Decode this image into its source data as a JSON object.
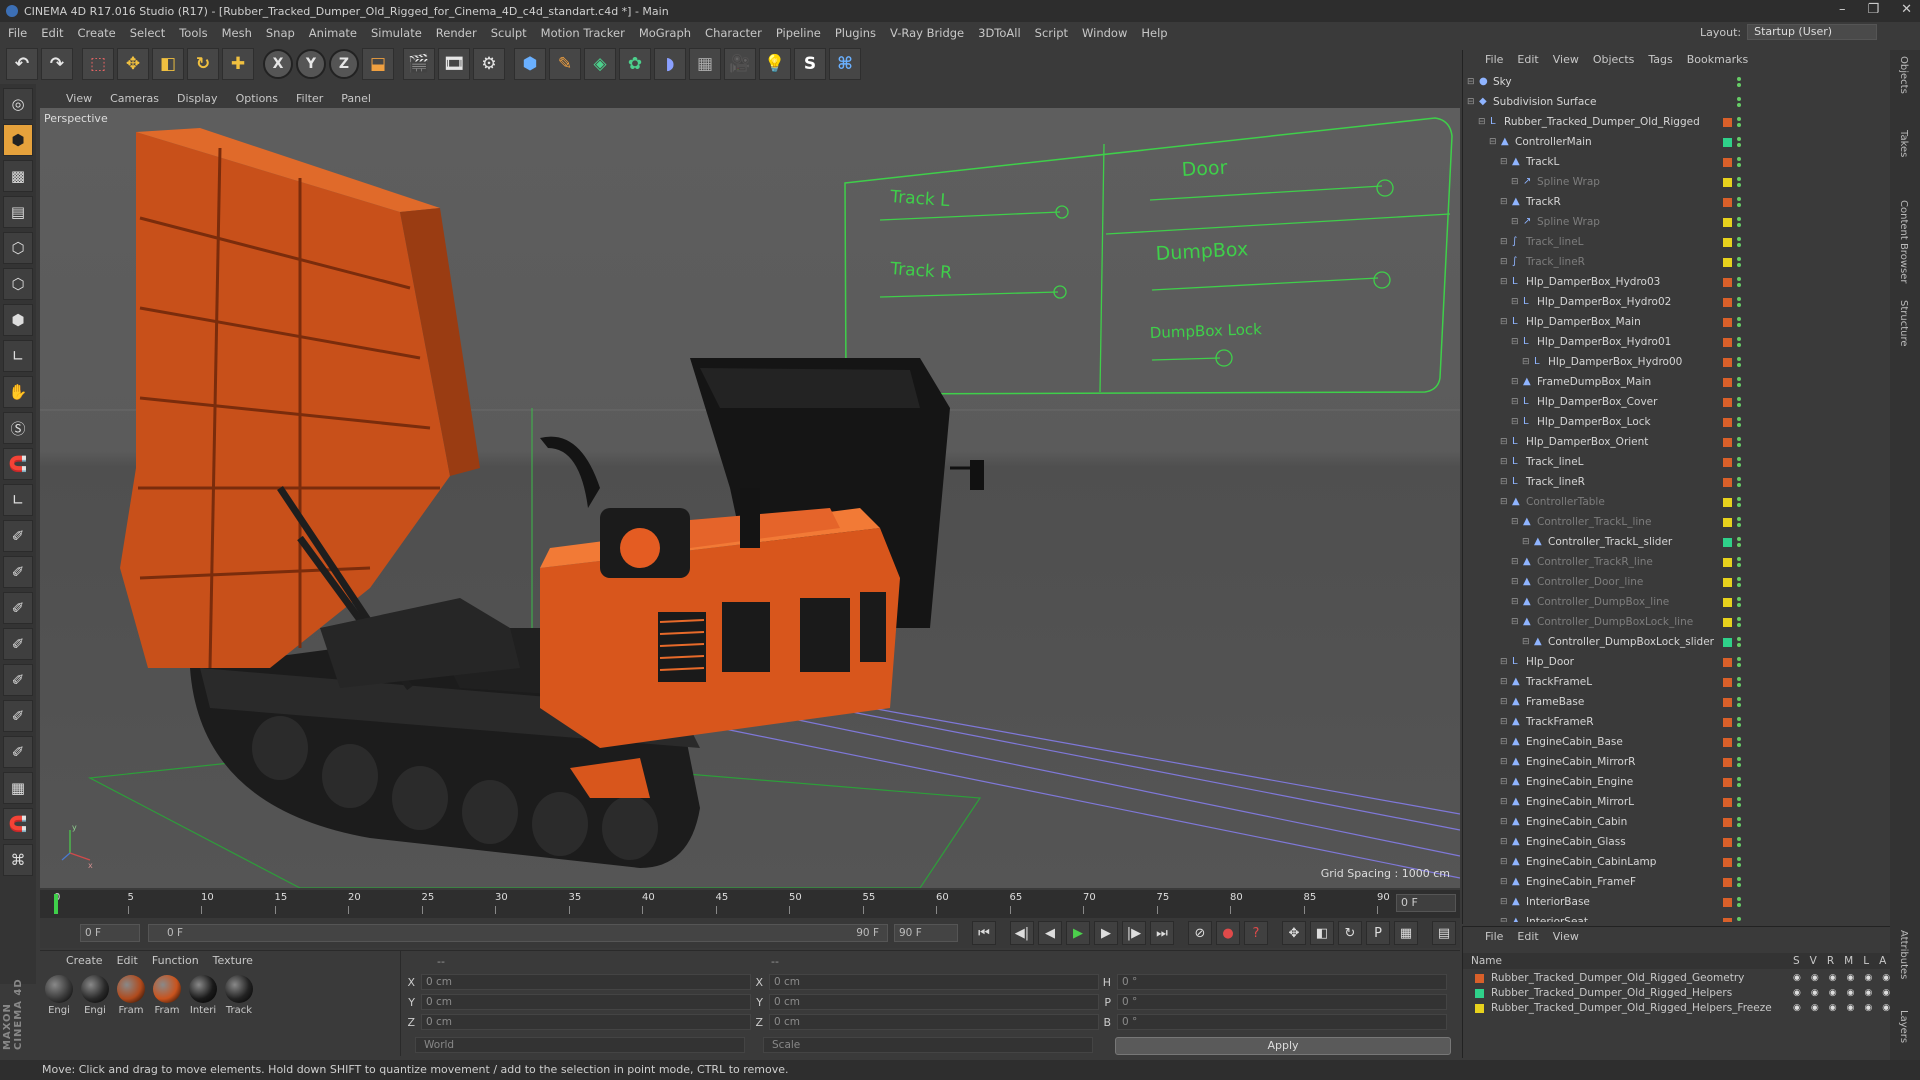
{
  "app": {
    "title": "CINEMA 4D R17.016 Studio (R17) - [Rubber_Tracked_Dumper_Old_Rigged_for_Cinema_4D_c4d_standart.c4d *] - Main",
    "menu": [
      "File",
      "Edit",
      "Create",
      "Select",
      "Tools",
      "Mesh",
      "Snap",
      "Animate",
      "Simulate",
      "Render",
      "Sculpt",
      "Motion Tracker",
      "MoGraph",
      "Character",
      "Pipeline",
      "Plugins",
      "V-Ray Bridge",
      "3DToAll",
      "Script",
      "Window",
      "Help"
    ],
    "layout_label": "Layout:",
    "layout_value": "Startup (User)",
    "maxon": "MAXON CINEMA 4D"
  },
  "toolbar": {
    "axis_x": "X",
    "axis_y": "Y",
    "axis_z": "Z"
  },
  "viewport": {
    "menu": [
      "View",
      "Cameras",
      "Display",
      "Options",
      "Filter",
      "Panel"
    ],
    "label": "Perspective",
    "grid_spacing": "Grid Spacing : 1000 cm",
    "controller_labels": {
      "track_l": "Track L",
      "track_r": "Track R",
      "door": "Door",
      "dumpbox": "DumpBox",
      "dumpbox_lock": "DumpBox Lock"
    },
    "axis_x": "x",
    "axis_y": "y"
  },
  "timeline": {
    "ticks": [
      "0",
      "5",
      "10",
      "15",
      "20",
      "25",
      "30",
      "35",
      "40",
      "45",
      "50",
      "55",
      "60",
      "65",
      "70",
      "75",
      "80",
      "85",
      "90"
    ],
    "current_frame": "0 F",
    "start_field": "0 F",
    "range_start": "0 F",
    "range_end": "90 F",
    "end_field": "90 F"
  },
  "materials": {
    "menu": [
      "Create",
      "Edit",
      "Function",
      "Texture"
    ],
    "items": [
      {
        "label": "Engi",
        "color": "#3a3a3a"
      },
      {
        "label": "Engi",
        "color": "#2a2a2a"
      },
      {
        "label": "Fram",
        "color": "#b04a1c"
      },
      {
        "label": "Fram",
        "color": "#c9531d"
      },
      {
        "label": "Interi",
        "color": "#1a1a1a"
      },
      {
        "label": "Track",
        "color": "#222222"
      }
    ]
  },
  "coords": {
    "header": "--",
    "header2": "--",
    "x_label": "X",
    "x_val": "0 cm",
    "y_label": "Y",
    "y_val": "0 cm",
    "z_label": "Z",
    "z_val": "0 cm",
    "sx_label": "X",
    "sx_val": "0 cm",
    "sy_label": "Y",
    "sy_val": "0 cm",
    "sz_label": "Z",
    "sz_val": "0 cm",
    "h_label": "H",
    "h_val": "0 °",
    "p_label": "P",
    "p_val": "0 °",
    "b_label": "B",
    "b_val": "0 °",
    "world": "World",
    "scale": "Scale",
    "apply": "Apply"
  },
  "objects": {
    "menu": [
      "File",
      "Edit",
      "View",
      "Objects",
      "Tags",
      "Bookmarks"
    ],
    "rows": [
      {
        "name": "Sky",
        "depth": 0,
        "dim": false,
        "layer": "",
        "icon": "●"
      },
      {
        "name": "Subdivision Surface",
        "depth": 0,
        "dim": false,
        "layer": "",
        "icon": "◆"
      },
      {
        "name": "Rubber_Tracked_Dumper_Old_Rigged",
        "depth": 1,
        "dim": false,
        "layer": "#d9602a",
        "icon": "L"
      },
      {
        "name": "ControllerMain",
        "depth": 2,
        "dim": false,
        "layer": "#2fd18a",
        "icon": "▲"
      },
      {
        "name": "TrackL",
        "depth": 3,
        "dim": false,
        "layer": "#d9602a",
        "icon": "▲"
      },
      {
        "name": "Spline Wrap",
        "depth": 4,
        "dim": true,
        "layer": "#e8d21d",
        "icon": "↗"
      },
      {
        "name": "TrackR",
        "depth": 3,
        "dim": false,
        "layer": "#d9602a",
        "icon": "▲"
      },
      {
        "name": "Spline Wrap",
        "depth": 4,
        "dim": true,
        "layer": "#e8d21d",
        "icon": "↗"
      },
      {
        "name": "Track_lineL",
        "depth": 3,
        "dim": true,
        "layer": "#e8d21d",
        "icon": "∫"
      },
      {
        "name": "Track_lineR",
        "depth": 3,
        "dim": true,
        "layer": "#e8d21d",
        "icon": "∫"
      },
      {
        "name": "Hlp_DamperBox_Hydro03",
        "depth": 3,
        "dim": false,
        "layer": "#d9602a",
        "icon": "L"
      },
      {
        "name": "Hlp_DamperBox_Hydro02",
        "depth": 4,
        "dim": false,
        "layer": "#d9602a",
        "icon": "L"
      },
      {
        "name": "Hlp_DamperBox_Main",
        "depth": 3,
        "dim": false,
        "layer": "#d9602a",
        "icon": "L"
      },
      {
        "name": "Hlp_DamperBox_Hydro01",
        "depth": 4,
        "dim": false,
        "layer": "#d9602a",
        "icon": "L"
      },
      {
        "name": "Hlp_DamperBox_Hydro00",
        "depth": 5,
        "dim": false,
        "layer": "#d9602a",
        "icon": "L"
      },
      {
        "name": "FrameDumpBox_Main",
        "depth": 4,
        "dim": false,
        "layer": "#d9602a",
        "icon": "▲"
      },
      {
        "name": "Hlp_DamperBox_Cover",
        "depth": 4,
        "dim": false,
        "layer": "#d9602a",
        "icon": "L"
      },
      {
        "name": "Hlp_DamperBox_Lock",
        "depth": 4,
        "dim": false,
        "layer": "#d9602a",
        "icon": "L"
      },
      {
        "name": "Hlp_DamperBox_Orient",
        "depth": 3,
        "dim": false,
        "layer": "#d9602a",
        "icon": "L"
      },
      {
        "name": "Track_lineL",
        "depth": 3,
        "dim": false,
        "layer": "#d9602a",
        "icon": "L"
      },
      {
        "name": "Track_lineR",
        "depth": 3,
        "dim": false,
        "layer": "#d9602a",
        "icon": "L"
      },
      {
        "name": "ControllerTable",
        "depth": 3,
        "dim": true,
        "layer": "#e8d21d",
        "icon": "▲"
      },
      {
        "name": "Controller_TrackL_line",
        "depth": 4,
        "dim": true,
        "layer": "#e8d21d",
        "icon": "▲"
      },
      {
        "name": "Controller_TrackL_slider",
        "depth": 5,
        "dim": false,
        "layer": "#2fd18a",
        "icon": "▲"
      },
      {
        "name": "Controller_TrackR_line",
        "depth": 4,
        "dim": true,
        "layer": "#e8d21d",
        "icon": "▲"
      },
      {
        "name": "Controller_Door_line",
        "depth": 4,
        "dim": true,
        "layer": "#e8d21d",
        "icon": "▲"
      },
      {
        "name": "Controller_DumpBox_line",
        "depth": 4,
        "dim": true,
        "layer": "#e8d21d",
        "icon": "▲"
      },
      {
        "name": "Controller_DumpBoxLock_line",
        "depth": 4,
        "dim": true,
        "layer": "#e8d21d",
        "icon": "▲"
      },
      {
        "name": "Controller_DumpBoxLock_slider",
        "depth": 5,
        "dim": false,
        "layer": "#2fd18a",
        "icon": "▲"
      },
      {
        "name": "Hlp_Door",
        "depth": 3,
        "dim": false,
        "layer": "#d9602a",
        "icon": "L"
      },
      {
        "name": "TrackFrameL",
        "depth": 3,
        "dim": false,
        "layer": "#d9602a",
        "icon": "▲"
      },
      {
        "name": "FrameBase",
        "depth": 3,
        "dim": false,
        "layer": "#d9602a",
        "icon": "▲"
      },
      {
        "name": "TrackFrameR",
        "depth": 3,
        "dim": false,
        "layer": "#d9602a",
        "icon": "▲"
      },
      {
        "name": "EngineCabin_Base",
        "depth": 3,
        "dim": false,
        "layer": "#d9602a",
        "icon": "▲"
      },
      {
        "name": "EngineCabin_MirrorR",
        "depth": 3,
        "dim": false,
        "layer": "#d9602a",
        "icon": "▲"
      },
      {
        "name": "EngineCabin_Engine",
        "depth": 3,
        "dim": false,
        "layer": "#d9602a",
        "icon": "▲"
      },
      {
        "name": "EngineCabin_MirrorL",
        "depth": 3,
        "dim": false,
        "layer": "#d9602a",
        "icon": "▲"
      },
      {
        "name": "EngineCabin_Cabin",
        "depth": 3,
        "dim": false,
        "layer": "#d9602a",
        "icon": "▲"
      },
      {
        "name": "EngineCabin_Glass",
        "depth": 3,
        "dim": false,
        "layer": "#d9602a",
        "icon": "▲"
      },
      {
        "name": "EngineCabin_CabinLamp",
        "depth": 3,
        "dim": false,
        "layer": "#d9602a",
        "icon": "▲"
      },
      {
        "name": "EngineCabin_FrameF",
        "depth": 3,
        "dim": false,
        "layer": "#d9602a",
        "icon": "▲"
      },
      {
        "name": "InteriorBase",
        "depth": 3,
        "dim": false,
        "layer": "#d9602a",
        "icon": "▲"
      },
      {
        "name": "InteriorSeat",
        "depth": 3,
        "dim": false,
        "layer": "#d9602a",
        "icon": "▲"
      }
    ]
  },
  "layers": {
    "menu": [
      "File",
      "Edit",
      "View"
    ],
    "col_name": "Name",
    "cols": [
      "S",
      "V",
      "R",
      "M",
      "L",
      "A"
    ],
    "rows": [
      {
        "name": "Rubber_Tracked_Dumper_Old_Rigged_Geometry",
        "color": "#d9602a"
      },
      {
        "name": "Rubber_Tracked_Dumper_Old_Rigged_Helpers",
        "color": "#2fd18a"
      },
      {
        "name": "Rubber_Tracked_Dumper_Old_Rigged_Helpers_Freeze",
        "color": "#e8d21d"
      }
    ]
  },
  "side_tabs": [
    "Objects",
    "Takes",
    "Content Browser",
    "Structure",
    "Attributes",
    "Layers"
  ],
  "status": "Move: Click and drag to move elements. Hold down SHIFT to quantize movement / add to the selection in point mode, CTRL to remove."
}
